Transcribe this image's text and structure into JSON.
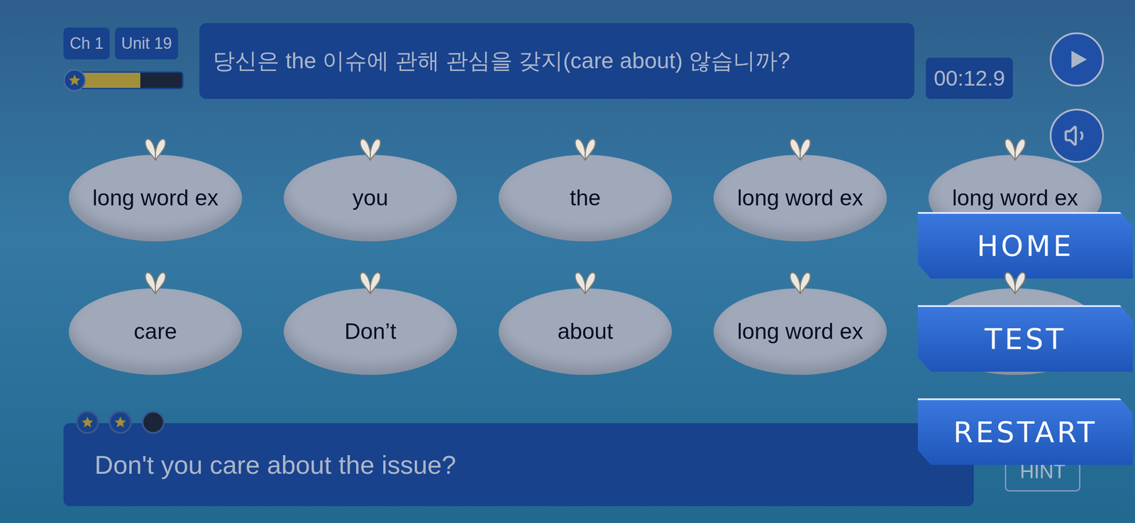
{
  "header": {
    "chapter": "Ch 1",
    "unit": "Unit 19",
    "progress": {
      "level": 0.6
    },
    "prompt": "당신은 the 이슈에 관해 관심을 갖지(care about) 않습니까?",
    "timer": "00:12.9"
  },
  "bags": [
    {
      "word": "long word ex"
    },
    {
      "word": "you"
    },
    {
      "word": "the"
    },
    {
      "word": "long word ex"
    },
    {
      "word": "long word ex"
    },
    {
      "word": "care"
    },
    {
      "word": "Don’t"
    },
    {
      "word": "about"
    },
    {
      "word": "long word ex"
    },
    {
      "word": ""
    }
  ],
  "answer": {
    "text": "Don't you care about the issue?",
    "stars": 2,
    "slots": 3
  },
  "hint_button": "HINT",
  "menu": [
    "HOME",
    "TEST",
    "RESTART"
  ]
}
